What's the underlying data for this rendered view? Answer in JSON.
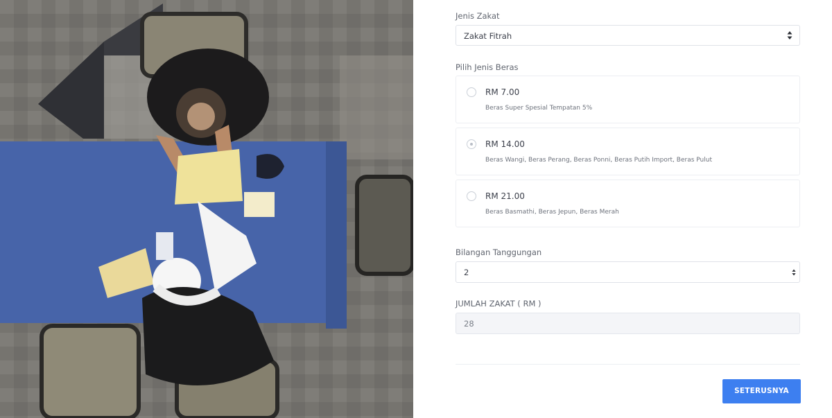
{
  "form": {
    "jenis_zakat": {
      "label": "Jenis Zakat",
      "value": "Zakat Fitrah"
    },
    "jenis_beras": {
      "label": "Pilih Jenis Beras",
      "options": [
        {
          "price": "RM 7.00",
          "description": "Beras Super Spesial Tempatan 5%",
          "selected": false
        },
        {
          "price": "RM 14.00",
          "description": "Beras Wangi, Beras Perang, Beras Ponni, Beras Putih Import, Beras Pulut",
          "selected": true
        },
        {
          "price": "RM 21.00",
          "description": "Beras Basmathi, Beras Jepun, Beras Merah",
          "selected": false
        }
      ]
    },
    "tanggungan": {
      "label": "Bilangan Tanggungan",
      "value": "2"
    },
    "jumlah": {
      "label": "JUMLAH ZAKAT ( RM )",
      "value": "28"
    },
    "submit_label": "SETERUSNYA"
  },
  "icons": {
    "select_caret": "sort-caret-icon",
    "radio": "radio-button-icon"
  },
  "colors": {
    "accent": "#3d7ff0",
    "border": "#dfe2e8",
    "readonly_bg": "#f4f5f8"
  }
}
